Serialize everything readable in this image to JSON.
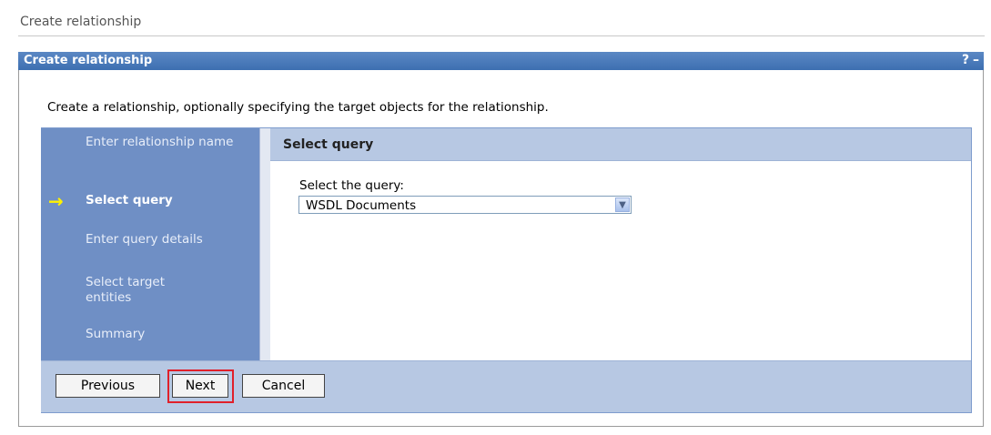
{
  "page": {
    "title": "Create relationship"
  },
  "portlet": {
    "title": "Create relationship",
    "help_glyph": "?",
    "minimize_glyph": "–"
  },
  "intro_text": "Create a relationship, optionally specifying the target objects for the relationship.",
  "wizard": {
    "current_step_indicator": "→",
    "steps": [
      {
        "label": "Enter relationship name",
        "current": false
      },
      {
        "label": "Select query",
        "current": true
      },
      {
        "label": "Enter query details",
        "current": false
      },
      {
        "label": "Select target entities",
        "current": false
      },
      {
        "label": "Summary",
        "current": false
      }
    ],
    "content": {
      "heading": "Select query",
      "query_label": "Select the query:",
      "query_value": "WSDL Documents"
    },
    "buttons": {
      "previous": "Previous",
      "next": "Next",
      "cancel": "Cancel"
    }
  },
  "colors": {
    "portlet_bar": "#3d6fb1",
    "steps_panel": "#6f8fc5",
    "content_header": "#b7c8e3",
    "current_step_arrow": "#fff200",
    "highlight": "#e0202a"
  }
}
